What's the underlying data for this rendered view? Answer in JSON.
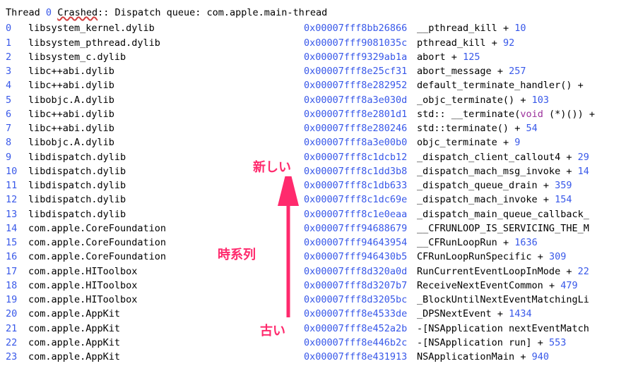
{
  "header": {
    "thread": "Thread",
    "index": "0",
    "crashed": "Crashed",
    "rest": ":: Dispatch queue: com.apple.main-thread"
  },
  "annotations": {
    "newest": "新しい",
    "timeline": "時系列",
    "oldest": "古い"
  },
  "frames": [
    {
      "idx": "0",
      "lib": "libsystem_kernel.dylib",
      "addr": "0x00007fff8bb26866",
      "func": "__pthread_kill",
      "plus": "+",
      "offset": "10"
    },
    {
      "idx": "1",
      "lib": "libsystem_pthread.dylib",
      "addr": "0x00007fff9081035c",
      "func": "pthread_kill",
      "plus": "+",
      "offset": "92"
    },
    {
      "idx": "2",
      "lib": "libsystem_c.dylib",
      "addr": "0x00007fff9329ab1a",
      "func": "abort",
      "plus": "+",
      "offset": "125"
    },
    {
      "idx": "3",
      "lib": "libc++abi.dylib",
      "addr": "0x00007fff8e25cf31",
      "func": "abort_message",
      "plus": "+",
      "offset": "257"
    },
    {
      "idx": "4",
      "lib": "libc++abi.dylib",
      "addr": "0x00007fff8e282952",
      "func": "default_terminate_handler()",
      "plus": "+",
      "offset": ""
    },
    {
      "idx": "5",
      "lib": "libobjc.A.dylib",
      "addr": "0x00007fff8a3e030d",
      "func": "_objc_terminate()",
      "plus": "+",
      "offset": "103"
    },
    {
      "idx": "6",
      "lib": "libc++abi.dylib",
      "addr": "0x00007fff8e2801d1",
      "func_pre": "std",
      "dcolon": "::",
      "func_post": " __terminate(",
      "void": "void",
      "func_tail": " (*)())",
      "plus": "+",
      "offset": ""
    },
    {
      "idx": "7",
      "lib": "libc++abi.dylib",
      "addr": "0x00007fff8e280246",
      "func_pre": "std",
      "dcolon": "::",
      "func_post": "terminate()",
      "plus": "+",
      "offset": "54"
    },
    {
      "idx": "8",
      "lib": "libobjc.A.dylib",
      "addr": "0x00007fff8a3e00b0",
      "func": "objc_terminate",
      "plus": "+",
      "offset": "9"
    },
    {
      "idx": "9",
      "lib": "libdispatch.dylib",
      "addr": "0x00007fff8c1dcb12",
      "func": "_dispatch_client_callout4",
      "plus": "+",
      "offset": "29"
    },
    {
      "idx": "10",
      "lib": "libdispatch.dylib",
      "addr": "0x00007fff8c1dd3b8",
      "func": "_dispatch_mach_msg_invoke",
      "plus": "+",
      "offset": "14"
    },
    {
      "idx": "11",
      "lib": "libdispatch.dylib",
      "addr": "0x00007fff8c1db633",
      "func": "_dispatch_queue_drain",
      "plus": "+",
      "offset": "359"
    },
    {
      "idx": "12",
      "lib": "libdispatch.dylib",
      "addr": "0x00007fff8c1dc69e",
      "func": "_dispatch_mach_invoke",
      "plus": "+",
      "offset": "154"
    },
    {
      "idx": "13",
      "lib": "libdispatch.dylib",
      "addr": "0x00007fff8c1e0eaa",
      "func": "_dispatch_main_queue_callback_",
      "plus": "",
      "offset": ""
    },
    {
      "idx": "14",
      "lib": "com.apple.CoreFoundation",
      "addr": "0x00007fff94688679",
      "func": "__CFRUNLOOP_IS_SERVICING_THE_M",
      "plus": "",
      "offset": ""
    },
    {
      "idx": "15",
      "lib": "com.apple.CoreFoundation",
      "addr": "0x00007fff94643954",
      "func": "__CFRunLoopRun",
      "plus": "+",
      "offset": "1636"
    },
    {
      "idx": "16",
      "lib": "com.apple.CoreFoundation",
      "addr": "0x00007fff946430b5",
      "func": "CFRunLoopRunSpecific",
      "plus": "+",
      "offset": "309"
    },
    {
      "idx": "17",
      "lib": "com.apple.HIToolbox",
      "addr": "0x00007fff8d320a0d",
      "func": "RunCurrentEventLoopInMode",
      "plus": "+",
      "offset": "22"
    },
    {
      "idx": "18",
      "lib": "com.apple.HIToolbox",
      "addr": "0x00007fff8d3207b7",
      "func": "ReceiveNextEventCommon",
      "plus": "+",
      "offset": "479"
    },
    {
      "idx": "19",
      "lib": "com.apple.HIToolbox",
      "addr": "0x00007fff8d3205bc",
      "func": "_BlockUntilNextEventMatchingLi",
      "plus": "",
      "offset": ""
    },
    {
      "idx": "20",
      "lib": "com.apple.AppKit",
      "addr": "0x00007fff8e4533de",
      "func": "_DPSNextEvent",
      "plus": "+",
      "offset": "1434"
    },
    {
      "idx": "21",
      "lib": "com.apple.AppKit",
      "addr": "0x00007fff8e452a2b",
      "func": "-[NSApplication nextEventMatch",
      "plus": "",
      "offset": ""
    },
    {
      "idx": "22",
      "lib": "com.apple.AppKit",
      "addr": "0x00007fff8e446b2c",
      "func": "-[NSApplication run]",
      "plus": "+",
      "offset": "553"
    },
    {
      "idx": "23",
      "lib": "com.apple.AppKit",
      "addr": "0x00007fff8e431913",
      "func": "NSApplicationMain",
      "plus": "+",
      "offset": "940"
    }
  ]
}
